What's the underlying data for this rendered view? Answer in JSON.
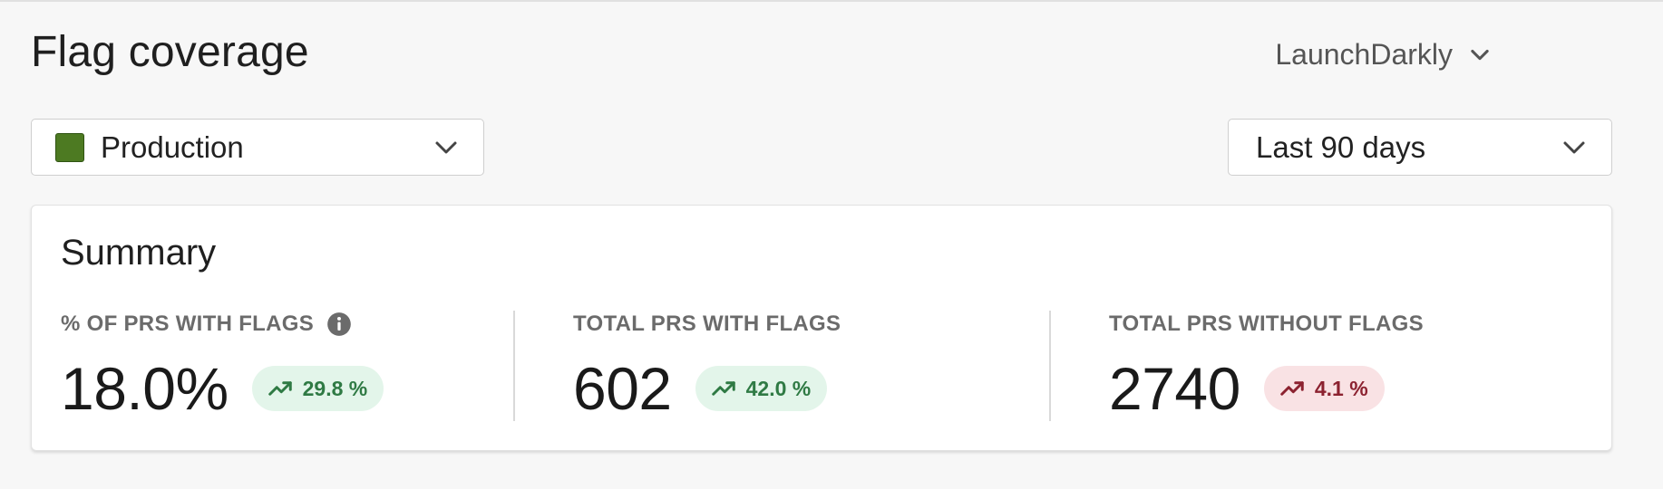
{
  "header": {
    "title": "Flag coverage",
    "provider": "LaunchDarkly"
  },
  "filters": {
    "environment": {
      "label": "Production",
      "color": "#4d7a22"
    },
    "date_range": {
      "label": "Last 90 days"
    }
  },
  "summary": {
    "title": "Summary",
    "metrics": [
      {
        "label": "% OF PRS WITH FLAGS",
        "value": "18.0%",
        "change": "29.8 %",
        "trend": "up",
        "tone": "positive",
        "icon": "info-icon"
      },
      {
        "label": "TOTAL PRS WITH FLAGS",
        "value": "602",
        "change": "42.0 %",
        "trend": "up",
        "tone": "positive"
      },
      {
        "label": "TOTAL PRS WITHOUT FLAGS",
        "value": "2740",
        "change": "4.1 %",
        "trend": "up",
        "tone": "negative"
      }
    ]
  },
  "colors": {
    "positive_bg": "#e3f5ea",
    "positive_text": "#2f7a44",
    "negative_bg": "#f9e2e4",
    "negative_text": "#8c2230"
  }
}
